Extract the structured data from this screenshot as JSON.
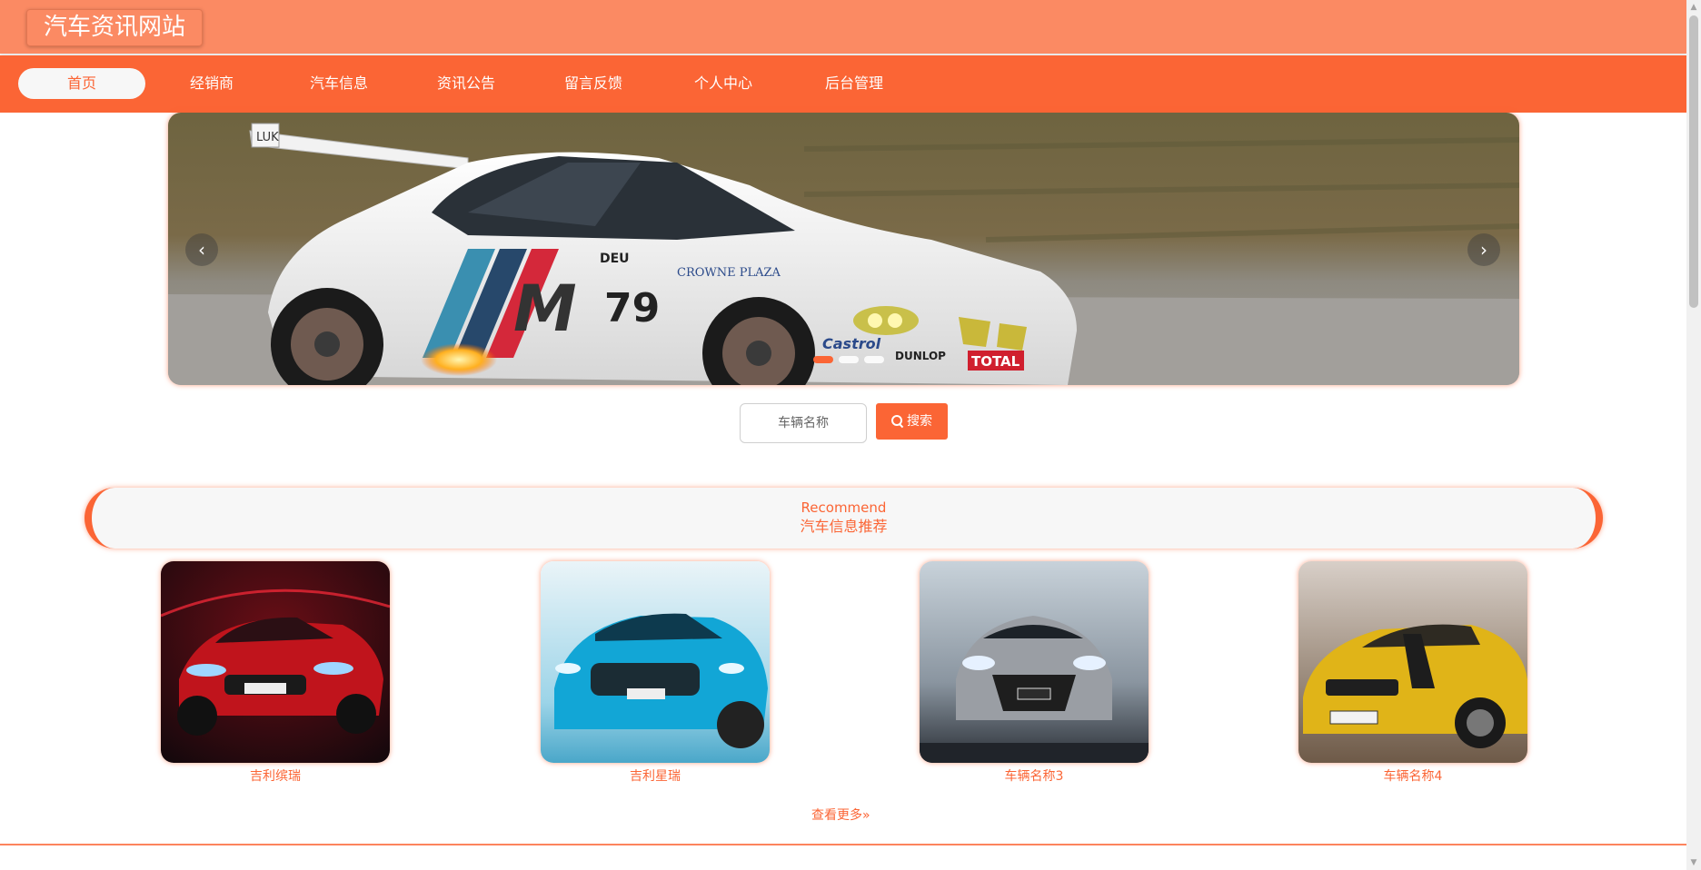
{
  "header": {
    "site_title": "汽车资讯网站"
  },
  "nav": {
    "items": [
      "首页",
      "经销商",
      "汽车信息",
      "资讯公告",
      "留言反馈",
      "个人中心",
      "后台管理"
    ],
    "active": "首页"
  },
  "carousel": {
    "prev_icon": "chevron-left-icon",
    "next_icon": "chevron-right-icon",
    "slide_count": 3,
    "active_slide": 1
  },
  "search": {
    "placeholder": "车辆名称",
    "button_label": "搜索",
    "button_icon": "search-icon"
  },
  "recommend": {
    "title_en": "Recommend",
    "title_cn": "汽车信息推荐",
    "cars": [
      {
        "name": "吉利缤瑞",
        "color": "#c0141c"
      },
      {
        "name": "吉利星瑞",
        "color": "#12a6d6"
      },
      {
        "name": "车辆名称3",
        "color": "#9a9ea4"
      },
      {
        "name": "车辆名称4",
        "color": "#e0b418"
      }
    ],
    "more_label": "查看更多",
    "more_icon": "double-chevron-right-icon"
  },
  "theme": {
    "accent": "#fb6535",
    "header_bg": "#fb8a63"
  }
}
